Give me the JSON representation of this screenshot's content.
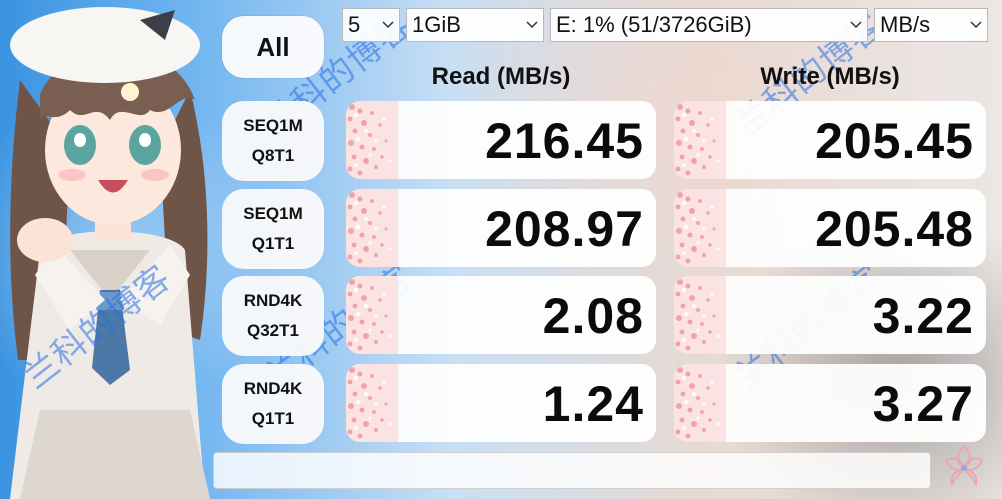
{
  "toolbar": {
    "count": {
      "value": "5"
    },
    "size": {
      "value": "1GiB"
    },
    "drive": {
      "value": "E: 1% (51/3726GiB)"
    },
    "unit": {
      "value": "MB/s"
    }
  },
  "all_button": {
    "label": "All"
  },
  "headers": {
    "read": "Read (MB/s)",
    "write": "Write (MB/s)"
  },
  "tests": [
    {
      "line1": "SEQ1M",
      "line2": "Q8T1",
      "read": "216.45",
      "write": "205.45"
    },
    {
      "line1": "SEQ1M",
      "line2": "Q1T1",
      "read": "208.97",
      "write": "205.48"
    },
    {
      "line1": "RND4K",
      "line2": "Q32T1",
      "read": "2.08",
      "write": "3.22"
    },
    {
      "line1": "RND4K",
      "line2": "Q1T1",
      "read": "1.24",
      "write": "3.27"
    }
  ],
  "status": {
    "message": ""
  },
  "watermark": {
    "text": "兰科的博客"
  },
  "colors": {
    "watermark": "#2f6fe6",
    "blossom": "#f2a9ad",
    "blossom_light": "#fbd9d9",
    "text": "#0b0b0b"
  }
}
